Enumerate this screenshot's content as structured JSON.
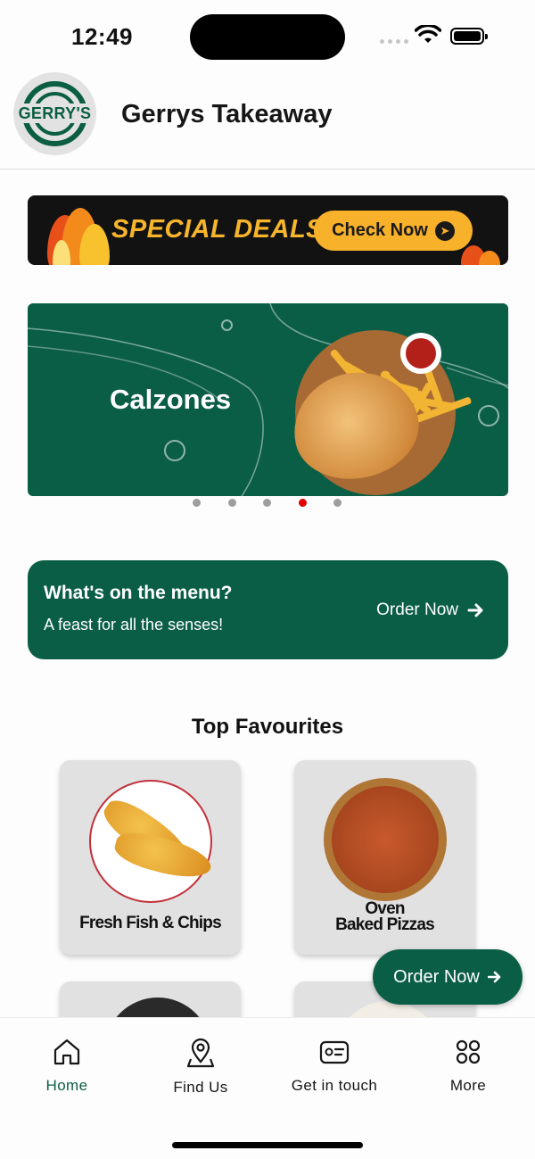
{
  "status_bar": {
    "time": "12:49"
  },
  "header": {
    "logo_text": "GERRY'S",
    "title": "Gerrys Takeaway"
  },
  "deals_banner": {
    "text": "SPECIAL DEALS",
    "button_label": "Check Now"
  },
  "carousel": {
    "title": "Calzones",
    "slide_count": 5,
    "active_index": 3
  },
  "menu_card": {
    "title": "What's on the menu?",
    "subtitle": "A feast for all the senses!",
    "action_label": "Order Now"
  },
  "favourites": {
    "title": "Top Favourites",
    "items": [
      {
        "label": "Fresh Fish & Chips"
      },
      {
        "label_line1": "Oven",
        "label_line2": "Baked Pizzas"
      }
    ]
  },
  "floating_button": {
    "label": "Order Now"
  },
  "bottom_nav": {
    "items": [
      {
        "label": "Home",
        "icon": "home-icon",
        "active": true
      },
      {
        "label": "Find Us",
        "icon": "map-pin-icon",
        "active": false
      },
      {
        "label": "Get in touch",
        "icon": "contact-card-icon",
        "active": false
      },
      {
        "label": "More",
        "icon": "grid-icon",
        "active": false
      }
    ]
  },
  "colors": {
    "brand_green": "#0b5e46",
    "deals_gold": "#f8b12b",
    "active_dot": "#e00000"
  }
}
